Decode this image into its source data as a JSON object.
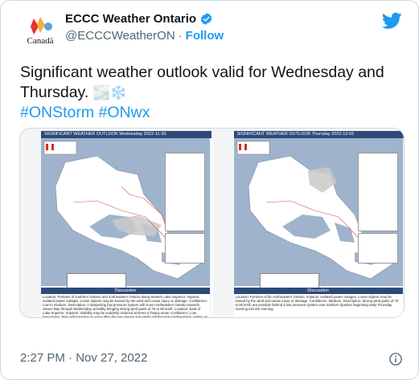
{
  "header": {
    "display_name": "ECCC Weather Ontario",
    "handle": "@ECCCWeatherON",
    "separator": "·",
    "follow_label": "Follow",
    "avatar_text": "Canadä"
  },
  "tweet": {
    "text": "Significant weather outlook valid for Wednesday and Thursday.",
    "emoji": "🌫️❄️",
    "hashtags": [
      "#ONStorm",
      "#ONwx"
    ],
    "timestamp": "2:27 PM · Nov 27, 2022"
  },
  "media": [
    {
      "title": "SIGNIFICANT WEATHER OUTLOOK Wednesday 2022-11-30",
      "discussion_header": "Discussion",
      "discussion": "Location: Portions of southern Ontario and northeastern Ontario along western Lake Superior. Impacts: Isolated power outages. Loose objects may be tossed by the wind and cause injury or damage. Confidence: Low to medium. Description: A deepening low pressure system will cross northeastern Ontario towards James Bay through Wednesday, possibly bringing strong wind gusts of 70 to 80 km/h. Location: East of Lake Superior. Impacts: Visibility may be suddenly reduced at times in heavy snow. Confidence: Low. Description: Rain will transition to snow after the low passes and winds will become northwesterly, setting up lake effect snowfall."
    },
    {
      "title": "SIGNIFICANT WEATHER OUTLOOK Thursday 2022-12-01",
      "discussion_header": "Discussion",
      "discussion": "Location: Portions of far northeastern Ontario. Impacts: Isolated power outages. Loose objects may be tossed by the wind and cause injury or damage. Confidence: Medium. Description: Strong wind gusts of 70 to 80 km/h are possible behind a low pressure system over northern Quebec beginning early Thursday morning into the evening."
    }
  ],
  "colors": {
    "accent": "#1d9bf0",
    "text": "#0f1419",
    "muted": "#536471",
    "border": "#cfd9de",
    "map_water": "#9fb4cc",
    "map_land": "#ffffff",
    "banner": "#2f4a78"
  },
  "icons": [
    "eccc-logo-icon",
    "verified-badge-icon",
    "twitter-bird-icon",
    "info-icon"
  ]
}
